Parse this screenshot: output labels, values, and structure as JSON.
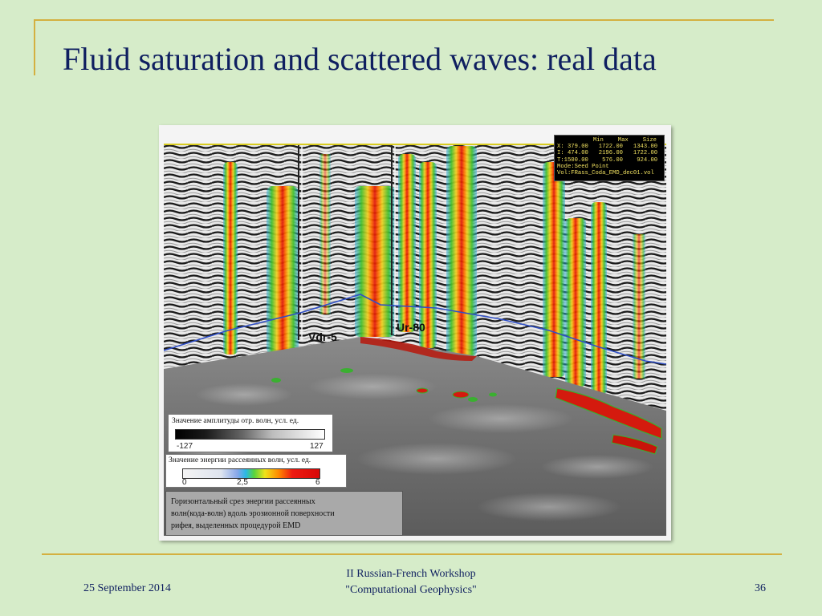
{
  "slide": {
    "title": "Fluid saturation and scattered waves: real data",
    "footer": {
      "date": "25 September 2014",
      "workshop_line1": "II Russian-French Workshop",
      "workshop_line2": "\"Computational Geophysics\"",
      "page_number": "36"
    }
  },
  "figure": {
    "wells": [
      {
        "label": "Vdr-5"
      },
      {
        "label": "Ur-80"
      }
    ],
    "info_panel": {
      "header": {
        "min": "Min",
        "max": "Max",
        "size": "Size"
      },
      "rows": [
        "X: 379.00   1722.00   1343.00",
        "I: 474.00   2196.00   1722.00",
        "T:1500.00    576.00    924.00",
        "Mode:Seed Point",
        "Vol:FRass_Coda_EMD_dec01.vol"
      ]
    },
    "legend_amplitude": {
      "title": "Значение амплитуды отр. волн, усл. ед.",
      "min": "-127",
      "max": "127"
    },
    "legend_energy": {
      "title": "Значение энергии рассеянных волн, усл. ед.",
      "ticks": [
        "0",
        "2,5",
        "6"
      ]
    },
    "caption": {
      "line1": "Горизонтальный срез энергии рассеянных",
      "line2": "волн(кода-волн) вдоль эрозионной поверхности",
      "line3": "рифея, выделенных процедурой EMD"
    }
  },
  "colors": {
    "background": "#d6ecc9",
    "title": "#0f1f60",
    "accent_lines": "#d4b040"
  }
}
